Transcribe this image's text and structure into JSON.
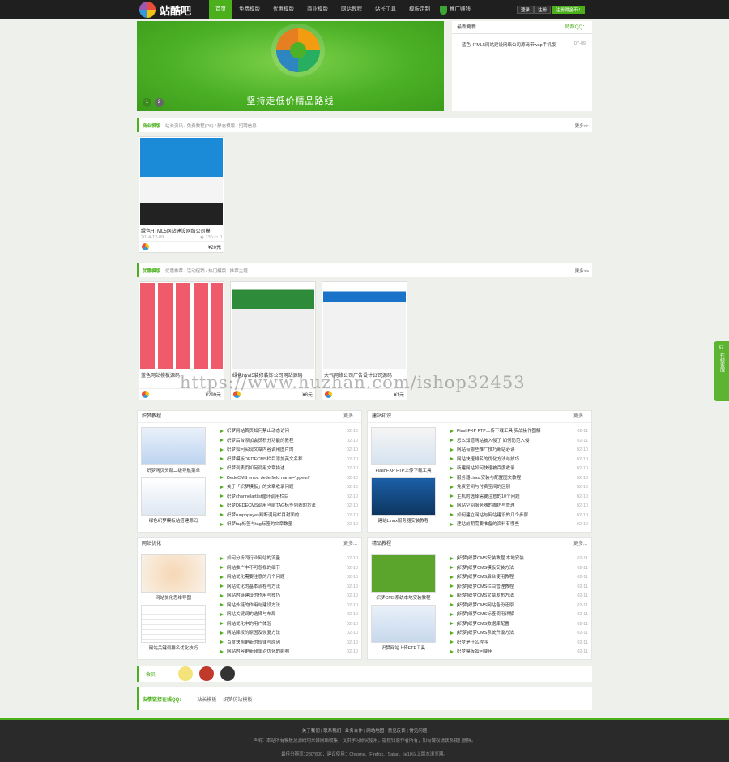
{
  "brand": {
    "name": "站酷吧"
  },
  "nav": {
    "items": [
      "首页",
      "免费模版",
      "优惠模版",
      "商业模版",
      "网站教程",
      "站长工具",
      "模板定制"
    ],
    "promote": "推广赚钱"
  },
  "auth": {
    "login": "登录",
    "register": "注册",
    "vip": "注册得金币 !"
  },
  "banner": {
    "slogan": "坚持走低价精品路线",
    "dots": [
      "1",
      "2"
    ]
  },
  "news": {
    "title": "最新更新",
    "qq": "特荐QQ：",
    "items": [
      {
        "text": "蓝色HTML5网站建设网络公司源码带wap手机版",
        "date": "07-09"
      }
    ]
  },
  "sections": {
    "biz": {
      "title": "商业模版",
      "sub": "站长资讯 / 免费教程(PS) / 静态模版 / 招聘信息",
      "more": "更多>>"
    },
    "free": {
      "title": "优惠模版",
      "sub": "优惠推荐 / 活动促销 / 热门模版 / 推荐主题",
      "more": "更多>>"
    }
  },
  "biz_cards": [
    {
      "name": "绿色HTML5网站建设网络公司模",
      "date": "2014-12-09",
      "views": "130",
      "comments": "0",
      "price": "¥20元"
    }
  ],
  "free_cards": [
    {
      "name": "蓝色网站模板源码",
      "price": "¥299元"
    },
    {
      "name": "绿色html5装修装饰公司网站源码",
      "price": "¥8元"
    },
    {
      "name": "大气网络公司广告设计公司源码",
      "price": "¥1元"
    }
  ],
  "boxes": [
    {
      "title": "织梦教程",
      "more": "更多...",
      "captions": [
        "织梦网页头部二级导航菜单",
        "绿色织梦模板站搭建源码"
      ],
      "items": [
        {
          "t": "织梦网站首页如何禁止动态访问",
          "d": "02-10"
        },
        {
          "t": "织梦后台添加会员积分功能的教程",
          "d": "02-10"
        },
        {
          "t": "织梦如何实现文章内容调用图片的",
          "d": "02-10"
        },
        {
          "t": "织梦模板DEDECMS栏目添加英文名称",
          "d": "02-10"
        },
        {
          "t": "织梦列表页如何调用文章描述",
          "d": "02-10"
        },
        {
          "t": "DedeCMS error: dede:field name='typeurl'",
          "d": "02-10"
        },
        {
          "t": "关于「织梦模板」的文章收录问题",
          "d": "02-10"
        },
        {
          "t": "织梦channelartlist循环调用栏目",
          "d": "02-10"
        },
        {
          "t": "织梦DEDECMS调用当前TAG标签列表的方法",
          "d": "02-10"
        },
        {
          "t": "织梦runphp=yes判断调用栏目封面的",
          "d": "02-10"
        },
        {
          "t": "织梦tag标签与tag标签的文章数量",
          "d": "02-10"
        }
      ]
    },
    {
      "title": "建站知识",
      "more": "更多...",
      "captions": [
        "FlashFXP FTP上传下载工具",
        "建站Linux服务器安装教程"
      ],
      "items": [
        {
          "t": "FlashFXP FTP上传下载工具 实战操作图解",
          "d": "02-11"
        },
        {
          "t": "怎么知道网站被入侵了 如何防范入侵",
          "d": "02-11"
        },
        {
          "t": "网站有哪些推广技巧新站必读",
          "d": "02-10"
        },
        {
          "t": "网站快速排名的优化方法与技巧",
          "d": "02-10"
        },
        {
          "t": "新建网站如何快速被百度收录",
          "d": "02-10"
        },
        {
          "t": "服务器Linux安装与配置图文教程",
          "d": "02-10"
        },
        {
          "t": "免费空间与付费空间的区别",
          "d": "02-10"
        },
        {
          "t": "主机的选择需要注意的10个问题",
          "d": "02-10"
        },
        {
          "t": "网站空间服务器的维护与管理",
          "d": "02-10"
        },
        {
          "t": "如何建立网站与网站建设的几个步骤",
          "d": "02-10"
        },
        {
          "t": "建站前期需要准备的资料有哪些",
          "d": "02-10"
        }
      ]
    },
    {
      "title": "网站优化",
      "more": "更多...",
      "captions": [
        "网站优化思维导图",
        "网站关键词排名优化技巧"
      ],
      "items": [
        {
          "t": "如何分析同行业网站的流量",
          "d": "02-10"
        },
        {
          "t": "网站推广中不可忽视的细节",
          "d": "02-10"
        },
        {
          "t": "网站优化需要注意的几个问题",
          "d": "02-10"
        },
        {
          "t": "网站优化的基本流程与方法",
          "d": "02-10"
        },
        {
          "t": "网站内链建设的作用与技巧",
          "d": "02-10"
        },
        {
          "t": "网站外链的作用与建设方法",
          "d": "02-10"
        },
        {
          "t": "网站关键词的选择与布局",
          "d": "02-10"
        },
        {
          "t": "网站优化中的用户体验",
          "d": "02-10"
        },
        {
          "t": "网站降权的原因及恢复方法",
          "d": "02-10"
        },
        {
          "t": "百度快照更新的规律与原因",
          "d": "02-10"
        },
        {
          "t": "网站内容更新频率对优化的影响",
          "d": "02-10"
        }
      ]
    },
    {
      "title": "精品教程",
      "more": "更多...",
      "captions": [
        "织梦CMS系统本地安装教程",
        "织梦网站上传FTP工具"
      ],
      "items": [
        {
          "t": "[织梦]织梦CMS安装教程 本地安装",
          "d": "02-11"
        },
        {
          "t": "[织梦]织梦CMS模板安装方法",
          "d": "02-11"
        },
        {
          "t": "[织梦]织梦CMS后台使用教程",
          "d": "02-11"
        },
        {
          "t": "[织梦]织梦CMS栏目管理教程",
          "d": "02-11"
        },
        {
          "t": "[织梦]织梦CMS文章发布方法",
          "d": "02-11"
        },
        {
          "t": "[织梦]织梦CMS网站备份还原",
          "d": "02-11"
        },
        {
          "t": "[织梦]织梦CMS标签调用详解",
          "d": "02-11"
        },
        {
          "t": "[织梦]织梦CMS数据库配置",
          "d": "02-11"
        },
        {
          "t": "[织梦]织梦CMS系统升级方法",
          "d": "02-11"
        },
        {
          "t": "织梦是什么程序",
          "d": "02-11"
        },
        {
          "t": "织梦模板如何使用",
          "d": "02-11"
        }
      ]
    }
  ],
  "friends": {
    "title": "会员"
  },
  "links": {
    "title": "友情链接在线QQ:",
    "items": [
      "站长模板",
      "织梦仿站模板"
    ]
  },
  "footer": {
    "links": "关于我们 | 联系我们 | 业务合作 | 网站地图 | 意见反馈 | 常见问题",
    "disclaimer": "声明：本站所有模板及源码均来自网络收集，仅供学习研究使用，版权归原作者所有，如有侵权请联系我们删除。",
    "copy": "最佳分辨率1280*800，建议使用：Chrome、Firefox、Safari、ie10以上版本浏览器。"
  },
  "kefu": {
    "label": "在线客服"
  },
  "watermark": "https://www.huzhan.com/ishop32453"
}
